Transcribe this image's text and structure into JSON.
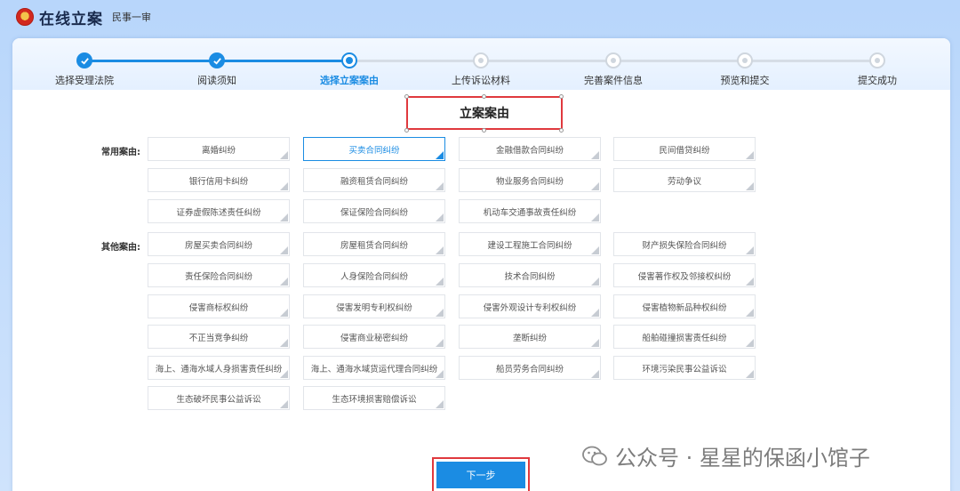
{
  "app": {
    "title": "在线立案",
    "subtitle": "民事一审"
  },
  "steps": [
    {
      "label": "选择受理法院",
      "state": "done"
    },
    {
      "label": "阅读须知",
      "state": "done"
    },
    {
      "label": "选择立案案由",
      "state": "current"
    },
    {
      "label": "上传诉讼材料",
      "state": "todo"
    },
    {
      "label": "完善案件信息",
      "state": "todo"
    },
    {
      "label": "预览和提交",
      "state": "todo"
    },
    {
      "label": "提交成功",
      "state": "todo"
    }
  ],
  "section": {
    "title": "立案案由"
  },
  "common": {
    "label": "常用案由:",
    "selected": "买卖合同纠纷",
    "items": [
      "离婚纠纷",
      "买卖合同纠纷",
      "金融借款合同纠纷",
      "民间借贷纠纷",
      "银行信用卡纠纷",
      "融资租赁合同纠纷",
      "物业服务合同纠纷",
      "劳动争议",
      "证券虚假陈述责任纠纷",
      "保证保险合同纠纷",
      "机动车交通事故责任纠纷"
    ]
  },
  "other": {
    "label": "其他案由:",
    "items": [
      "房屋买卖合同纠纷",
      "房屋租赁合同纠纷",
      "建设工程施工合同纠纷",
      "财产损失保险合同纠纷",
      "责任保险合同纠纷",
      "人身保险合同纠纷",
      "技术合同纠纷",
      "侵害著作权及邻接权纠纷",
      "侵害商标权纠纷",
      "侵害发明专利权纠纷",
      "侵害外观设计专利权纠纷",
      "侵害植物新品种权纠纷",
      "不正当竞争纠纷",
      "侵害商业秘密纠纷",
      "垄断纠纷",
      "船舶碰撞损害责任纠纷",
      "海上、通海水域人身损害责任纠纷",
      "海上、通海水域货运代理合同纠纷",
      "船员劳务合同纠纷",
      "环境污染民事公益诉讼",
      "生态破坏民事公益诉讼",
      "生态环境损害赔偿诉讼"
    ]
  },
  "actions": {
    "next_label": "下一步"
  },
  "watermark": {
    "text": "公众号 · 星星的保函小馆子"
  },
  "colors": {
    "accent": "#1b8ce3",
    "highlight": "#e0393e"
  }
}
